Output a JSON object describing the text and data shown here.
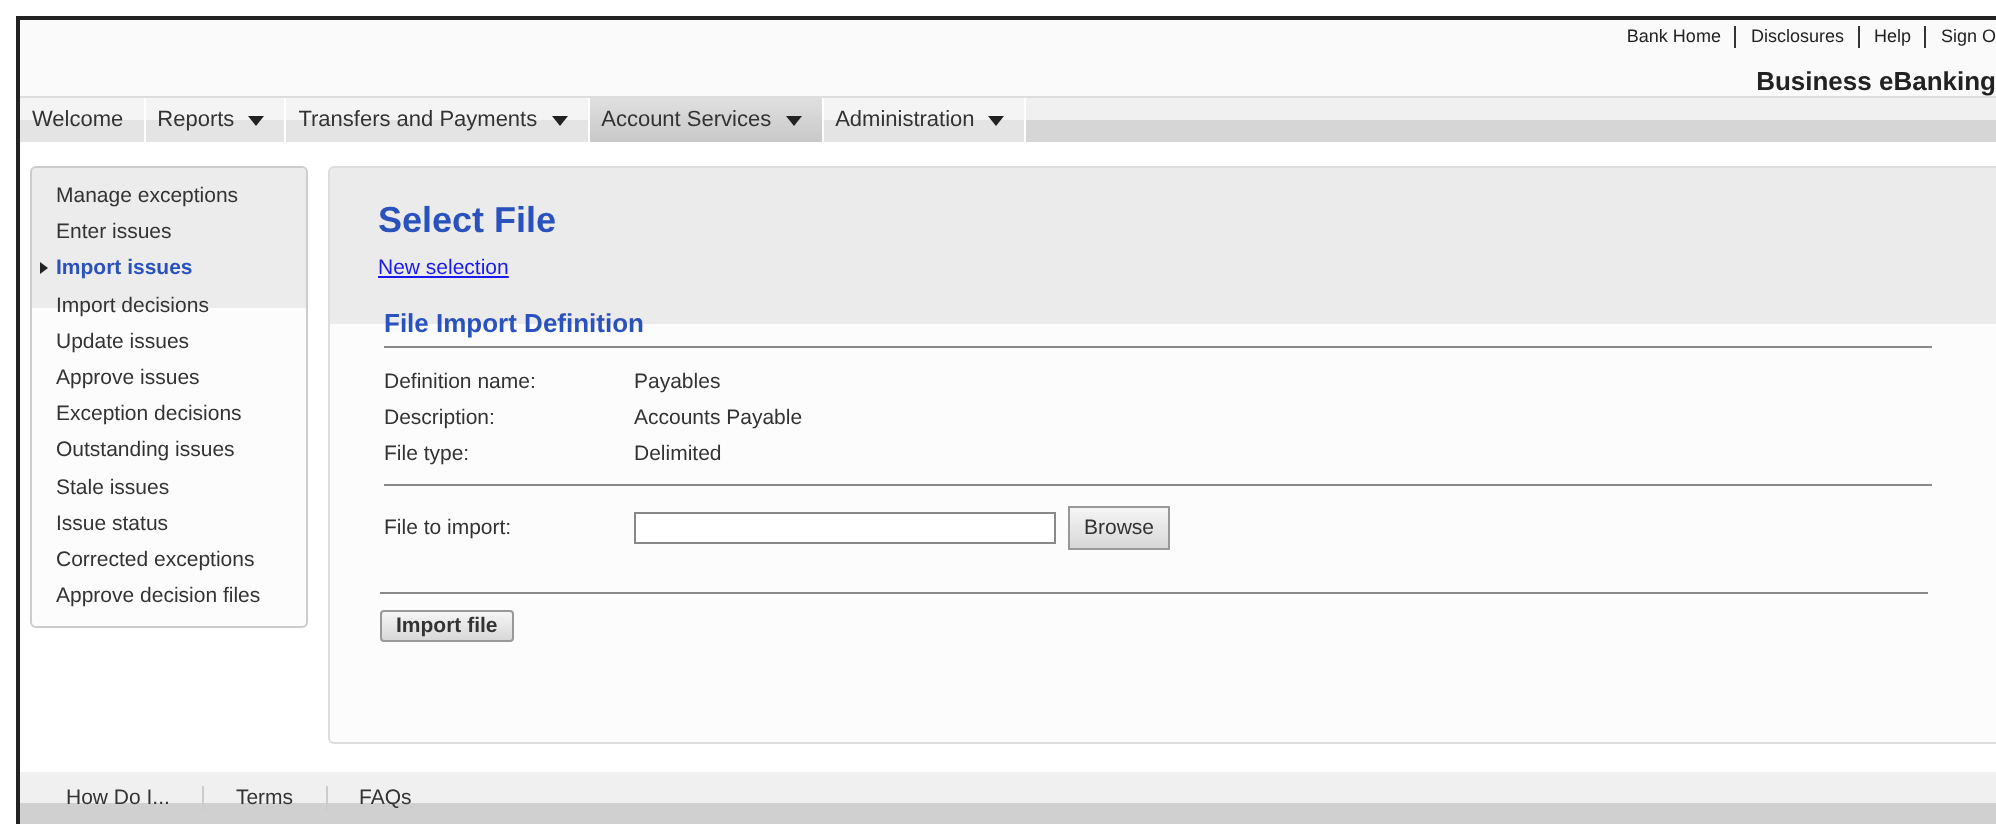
{
  "top_links": [
    "Bank Home",
    "Disclosures",
    "Help",
    "Sign O"
  ],
  "brand": "Business eBanking",
  "nav": [
    {
      "label": "Welcome",
      "dropdown": false,
      "selected": false
    },
    {
      "label": "Reports",
      "dropdown": true,
      "selected": false
    },
    {
      "label": "Transfers and Payments",
      "dropdown": true,
      "selected": false
    },
    {
      "label": "Account Services",
      "dropdown": true,
      "selected": true
    },
    {
      "label": "Administration",
      "dropdown": true,
      "selected": false
    }
  ],
  "sidebar": {
    "items": [
      {
        "label": "Manage exceptions",
        "selected": false
      },
      {
        "label": "Enter issues",
        "selected": false
      },
      {
        "label": "Import issues",
        "selected": true
      },
      {
        "label": "Import decisions",
        "selected": false
      },
      {
        "label": "Update issues",
        "selected": false
      },
      {
        "label": "Approve issues",
        "selected": false
      },
      {
        "label": "Exception decisions",
        "selected": false
      },
      {
        "label": "Outstanding issues",
        "selected": false
      },
      {
        "label": "Stale issues",
        "selected": false
      },
      {
        "label": "Issue status",
        "selected": false
      },
      {
        "label": "Corrected exceptions",
        "selected": false
      },
      {
        "label": "Approve decision files",
        "selected": false
      }
    ]
  },
  "page": {
    "title": "Select File",
    "link": "New selection",
    "section": "File Import Definition",
    "fields": [
      {
        "label": "Definition name:",
        "value": "Payables"
      },
      {
        "label": "Description:",
        "value": "Accounts Payable"
      },
      {
        "label": "File type:",
        "value": "Delimited"
      }
    ],
    "file_label": "File to import:",
    "browse": "Browse",
    "submit": "Import file"
  },
  "footer": [
    "How Do I...",
    "Terms",
    "FAQs"
  ]
}
